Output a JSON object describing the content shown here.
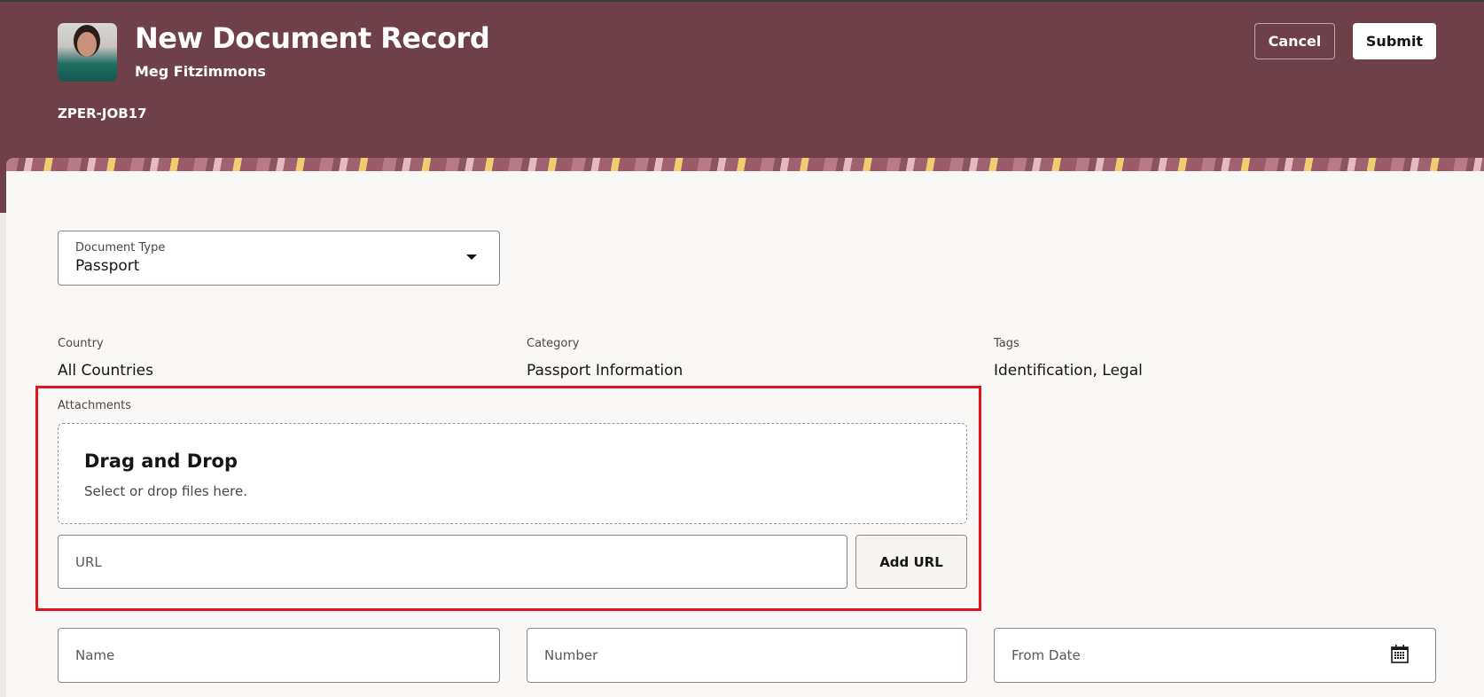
{
  "header": {
    "title": "New Document Record",
    "person": "Meg Fitzimmons",
    "code": "ZPER-JOB17",
    "cancel_label": "Cancel",
    "submit_label": "Submit"
  },
  "document_type": {
    "label": "Document Type",
    "value": "Passport"
  },
  "summary": [
    {
      "label": "Country",
      "value": "All Countries"
    },
    {
      "label": "Category",
      "value": "Passport Information"
    },
    {
      "label": "Tags",
      "value": "Identification, Legal"
    }
  ],
  "attachments": {
    "label": "Attachments",
    "drop_title": "Drag and Drop",
    "drop_hint": "Select or drop files here.",
    "url_placeholder": "URL",
    "add_url_label": "Add URL"
  },
  "fields": {
    "name": "Name",
    "number": "Number",
    "from_date": "From Date"
  },
  "colors": {
    "header": "#6f3f4a",
    "highlight": "#e0141c",
    "panel": "#f9f8f6"
  }
}
